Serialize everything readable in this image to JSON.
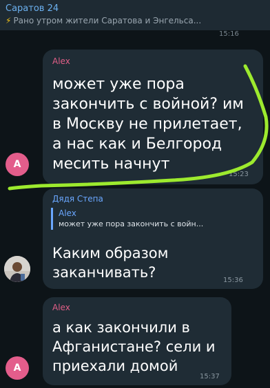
{
  "pinned": {
    "title": "Саратов 24",
    "bolt": "⚡",
    "text": "Рано утром жители Саратова и Энгельса..."
  },
  "prev_time": "15:16",
  "messages": [
    {
      "sender": "Alex",
      "avatar_letter": "A",
      "lines": [
        "может уже пора",
        "закончить с войной? им",
        "в Москву не прилетает,",
        "а нас как и Белгород",
        "месить начнут"
      ],
      "time": "15:23"
    },
    {
      "sender": "Дядя Степа",
      "reply_to": {
        "name": "Alex",
        "text": "может уже пора закончить с войн..."
      },
      "lines": [
        "Каким образом",
        "заканчивать?"
      ],
      "time": "15:36"
    },
    {
      "sender": "Alex",
      "avatar_letter": "A",
      "lines": [
        "а как закончили в",
        "Афганистане? сели и",
        "приехали домой"
      ],
      "time": "15:37"
    }
  ],
  "colors": {
    "background": "#0d1418",
    "bubble": "#1f2c35",
    "alex_name": "#e25f88",
    "reply_name": "#6aa7ff",
    "highlight": "#9dea2e"
  }
}
